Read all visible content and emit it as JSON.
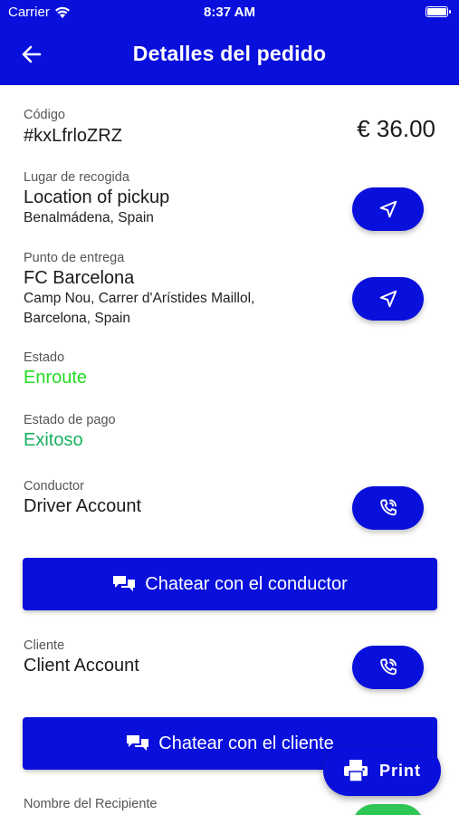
{
  "status_bar": {
    "carrier": "Carrier",
    "time": "8:37 AM"
  },
  "header": {
    "title": "Detalles del pedido"
  },
  "order": {
    "code_label": "Código",
    "code_value": "#kxLfrloZRZ",
    "price": "€ 36.00"
  },
  "pickup": {
    "label": "Lugar de recogida",
    "name": "Location of pickup",
    "address": "Benalmádena, Spain"
  },
  "delivery": {
    "label": "Punto de entrega",
    "name": "FC Barcelona",
    "address_line1": "Camp Nou, Carrer d'Arístides Maillol,",
    "address_line2": "Barcelona, Spain"
  },
  "state": {
    "label": "Estado",
    "value": "Enroute",
    "color": "#22dd22"
  },
  "payment": {
    "label": "Estado de pago",
    "value": "Exitoso",
    "color": "#17b060"
  },
  "driver": {
    "label": "Conductor",
    "name": "Driver Account",
    "chat_button": "Chatear con el conductor"
  },
  "client": {
    "label": "Cliente",
    "name": "Client Account",
    "chat_button": "Chatear con el cliente"
  },
  "recipient": {
    "label": "Nombre del Recipiente"
  },
  "print_button": "Print",
  "colors": {
    "primary": "#0a10dc",
    "green_button": "#2ec655"
  }
}
